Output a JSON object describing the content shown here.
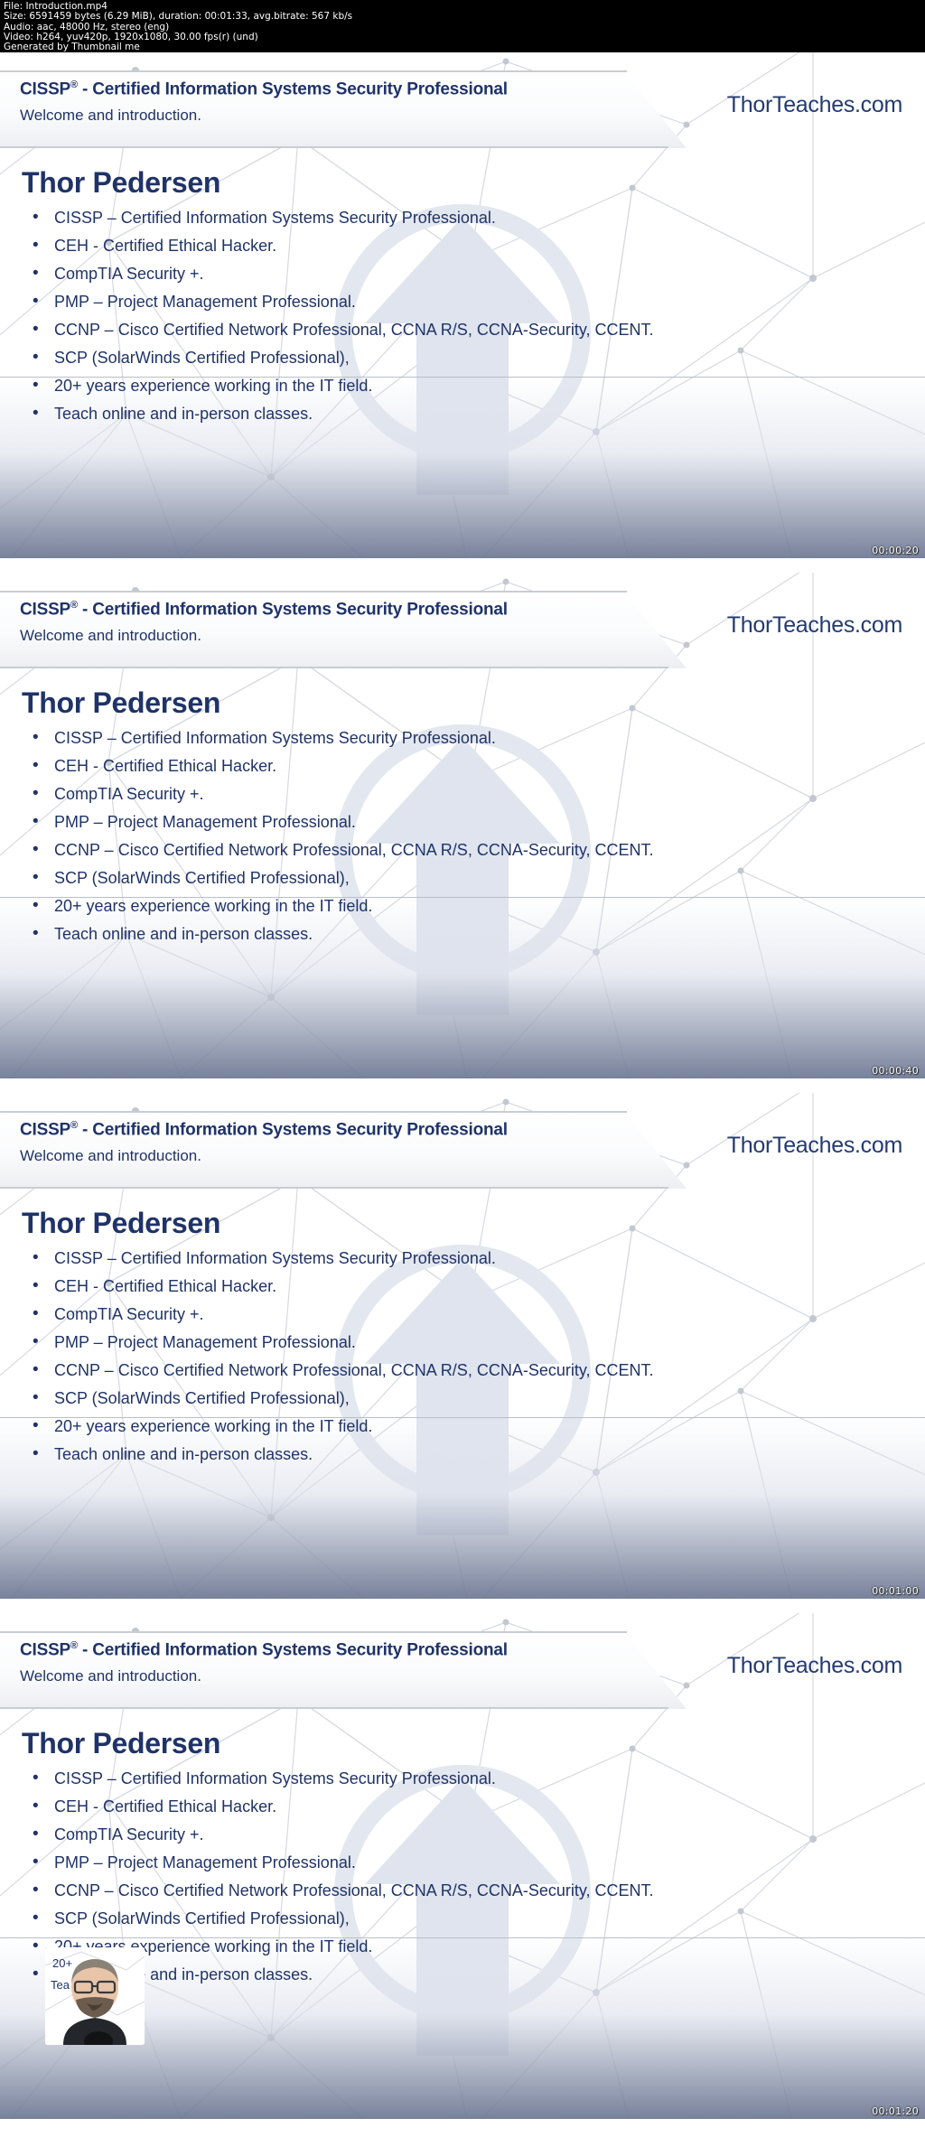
{
  "metadata": {
    "file_line": "File: Introduction.mp4",
    "size_line": "Size: 6591459 bytes (6.29 MiB), duration: 00:01:33, avg.bitrate: 567 kb/s",
    "audio_line": "Audio: aac, 48000 Hz, stereo (eng)",
    "video_line": "Video: h264, yuv420p, 1920x1080, 30.00 fps(r) (und)",
    "generator_line": "Generated by Thumbnail me"
  },
  "slide": {
    "banner_title_main": "CISSP",
    "banner_title_sup": "®",
    "banner_title_rest": " - Certified Information Systems Security Professional",
    "banner_subtitle": "Welcome and introduction.",
    "brand": "ThorTeaches.com",
    "headline": "Thor Pedersen",
    "bullets": [
      "CISSP – Certified Information Systems Security Professional.",
      "CEH - Certified Ethical Hacker.",
      "CompTIA Security +.",
      "PMP – Project Management Professional.",
      "CCNP – Cisco Certified Network Professional, CCNA R/S, CCNA-Security, CCENT.",
      "SCP (SolarWinds Certified Professional),",
      "20+ years experience working in the IT field.",
      "Teach online and in-person classes."
    ]
  },
  "thumbnails": [
    {
      "timestamp": "00:00:20",
      "has_webcam": false
    },
    {
      "timestamp": "00:00:40",
      "has_webcam": false
    },
    {
      "timestamp": "00:01:00",
      "has_webcam": false
    },
    {
      "timestamp": "00:01:20",
      "has_webcam": true
    }
  ],
  "colors": {
    "navy": "#1f3368",
    "brand_navy": "#243a72",
    "header_bg": "#000000",
    "header_fg": "#ffffff",
    "slide_bg": "#ffffff",
    "footer_gradient_end": "#6c7792",
    "watermark": "#dde2eb"
  }
}
